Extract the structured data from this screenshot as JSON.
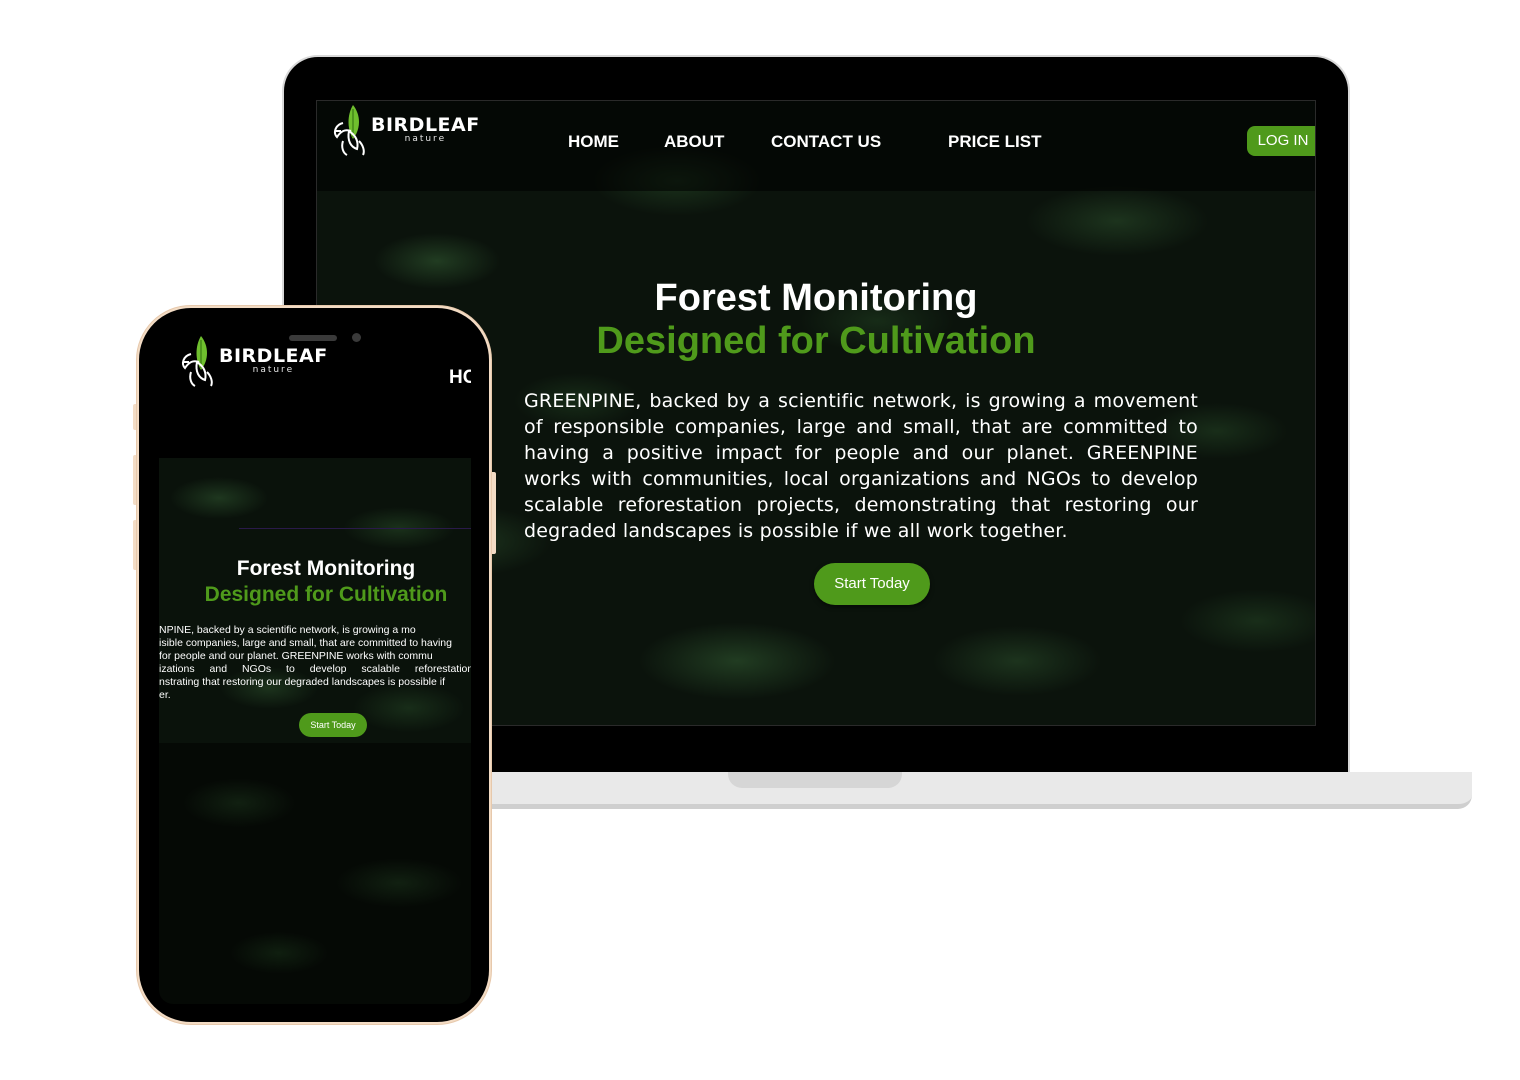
{
  "site": {
    "brand": "BIRDLEAF",
    "brand_sub": "nature",
    "nav": [
      "HOME",
      "ABOUT",
      "CONTACT US",
      "PRICE LIST"
    ],
    "login_label": "LOG IN",
    "hero_title": "Forest Monitoring",
    "hero_subtitle": "Designed for Cultivation",
    "hero_body": "GREENPINE, backed by a scientific network, is growing a movement of responsible companies, large and small, that are committed to having a positive impact for people and our planet. GREENPINE works with communities, local organizations and NGOs to develop scalable reforestation projects, demonstrating that restoring our degraded landscapes is possible if we all work together.",
    "cta_label": "Start Today"
  },
  "phone": {
    "nav_partial": "HC",
    "body_lines": [
      "NPINE, backed by a scientific network, is growing a mo",
      "isible companies, large and small, that are committed to having",
      " for people and our planet. GREENPINE works with commu",
      "izations and NGOs to develop scalable reforestation",
      "nstrating that restoring our degraded landscapes is possible if",
      "er."
    ]
  },
  "colors": {
    "accent": "#4f9a1b",
    "background": "#0b130c"
  },
  "icons": {
    "logo": "bird-leaf-logo-icon"
  }
}
